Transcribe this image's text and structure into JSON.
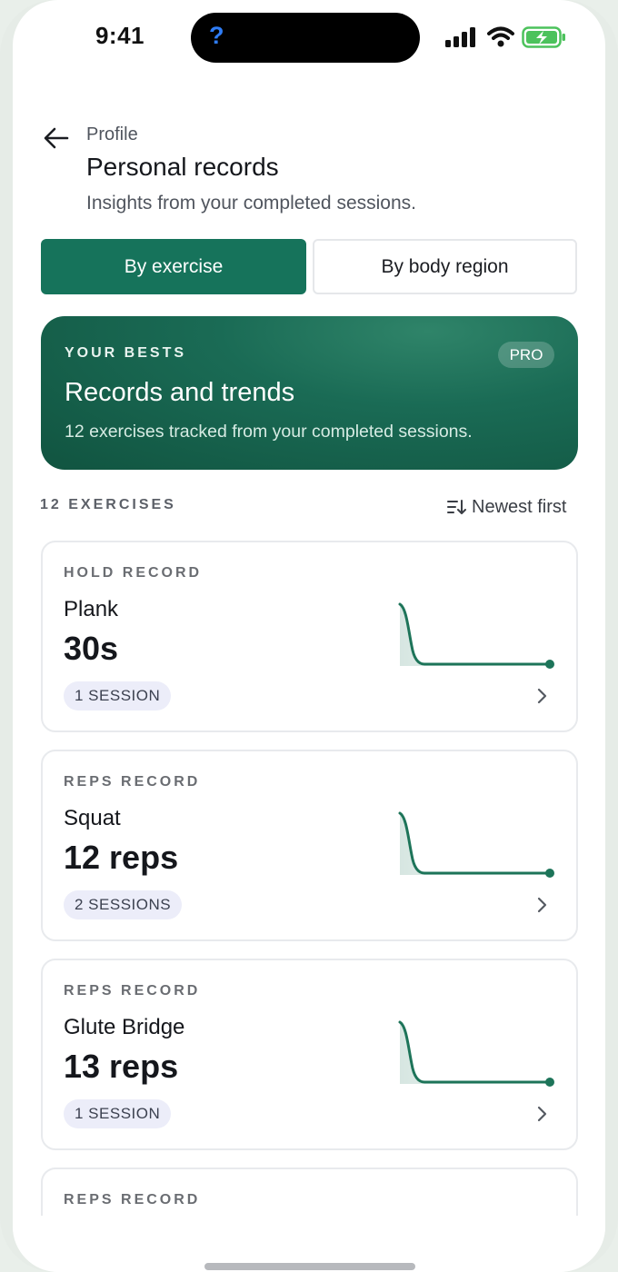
{
  "status_bar": {
    "time": "9:41",
    "island_icon": "?",
    "icons": [
      "cellular-signal-icon",
      "wifi-icon",
      "battery-charging-icon"
    ]
  },
  "header": {
    "breadcrumb": "Profile",
    "title": "Personal records",
    "subtitle": "Insights from your completed sessions."
  },
  "tabs": [
    {
      "label": "By exercise",
      "selected": true
    },
    {
      "label": "By body region",
      "selected": false
    }
  ],
  "hero": {
    "eyebrow": "YOUR BESTS",
    "badge": "PRO",
    "title": "Records and trends",
    "description": "12 exercises tracked from your completed sessions."
  },
  "list": {
    "count_label": "12 EXERCISES",
    "sort_label": "Newest first",
    "records": [
      {
        "type": "HOLD RECORD",
        "name": "Plank",
        "value": "30s",
        "sessions": "1 SESSION"
      },
      {
        "type": "REPS RECORD",
        "name": "Squat",
        "value": "12 reps",
        "sessions": "2 SESSIONS"
      },
      {
        "type": "REPS RECORD",
        "name": "Glute Bridge",
        "value": "13 reps",
        "sessions": "1 SESSION"
      },
      {
        "type": "REPS RECORD"
      }
    ]
  },
  "colors": {
    "accent": "#16735b",
    "hero_dark": "#115440",
    "sparkline": "#1d7459",
    "pill_bg": "#ecedf9"
  }
}
